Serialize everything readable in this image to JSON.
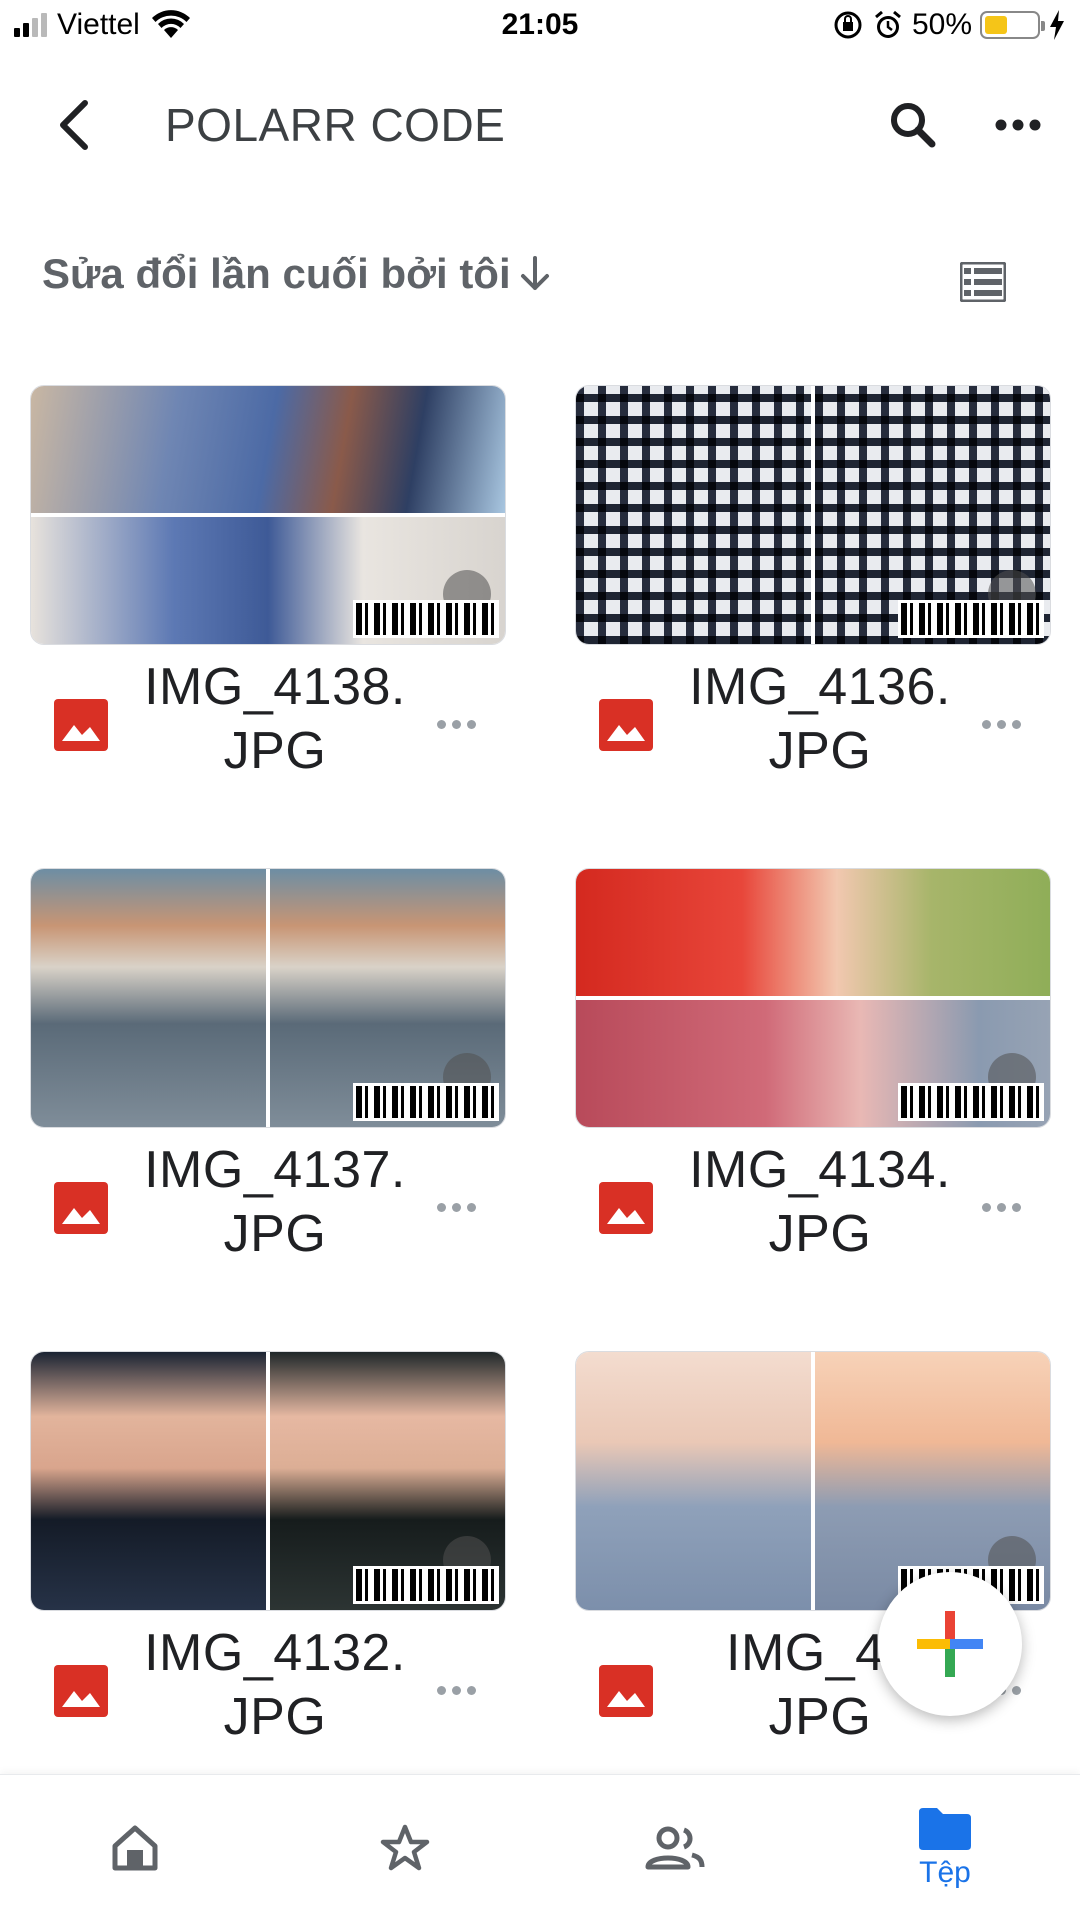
{
  "status_bar": {
    "carrier": "Viettel",
    "time": "21:05",
    "battery_percent": "50%",
    "battery_level": 0.5,
    "battery_color": "#f5c518"
  },
  "app_bar": {
    "back_icon": "chevron-left-icon",
    "title": "POLARR CODE",
    "search_icon": "search-icon",
    "more_icon": "more-horizontal-icon"
  },
  "sort": {
    "label": "Sửa đổi lần cuối bởi tôi",
    "direction_icon": "arrow-down-icon",
    "view_icon": "list-view-icon"
  },
  "files": [
    {
      "name_line1": "IMG_4138.",
      "name_line2": "JPG",
      "type_icon": "image-file-icon"
    },
    {
      "name_line1": "IMG_4136.",
      "name_line2": "JPG",
      "type_icon": "image-file-icon"
    },
    {
      "name_line1": "IMG_4137.",
      "name_line2": "JPG",
      "type_icon": "image-file-icon"
    },
    {
      "name_line1": "IMG_4134.",
      "name_line2": "JPG",
      "type_icon": "image-file-icon"
    },
    {
      "name_line1": "IMG_4132.",
      "name_line2": "JPG",
      "type_icon": "image-file-icon"
    },
    {
      "name_line1": "IMG_41",
      "name_line2": "JPG",
      "type_icon": "image-file-icon"
    }
  ],
  "fab": {
    "icon": "plus-icon"
  },
  "bottom_nav": {
    "items": [
      {
        "icon": "home-icon",
        "label": ""
      },
      {
        "icon": "star-icon",
        "label": ""
      },
      {
        "icon": "shared-people-icon",
        "label": ""
      },
      {
        "icon": "folder-icon",
        "label": "Tệp",
        "active": true
      }
    ]
  },
  "colors": {
    "accent": "#1a73e8",
    "image_file_red": "#d93025"
  }
}
